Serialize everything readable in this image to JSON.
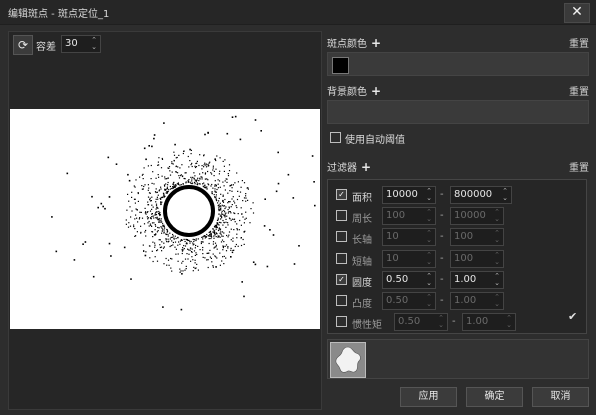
{
  "window": {
    "title": "编辑斑点 - 斑点定位_1",
    "close_glyph": "✕"
  },
  "toolbar": {
    "refresh_glyph": "⟳",
    "tolerance_label": "容差",
    "tolerance_value": "30"
  },
  "spot_color": {
    "label": "斑点颜色",
    "plus": "+",
    "reset": "重置",
    "color": "#000000"
  },
  "bg_color": {
    "label": "背景颜色",
    "plus": "+",
    "reset": "重置"
  },
  "auto_threshold": {
    "label": "使用自动阈值",
    "checked": false
  },
  "filters": {
    "label": "过滤器",
    "plus": "+",
    "reset": "重置",
    "rows": [
      {
        "name": "面积",
        "checked": true,
        "min": "10000",
        "max": "800000"
      },
      {
        "name": "周长",
        "checked": false,
        "min": "100",
        "max": "10000"
      },
      {
        "name": "长轴",
        "checked": false,
        "min": "10",
        "max": "100"
      },
      {
        "name": "短轴",
        "checked": false,
        "min": "10",
        "max": "100"
      },
      {
        "name": "圆度",
        "checked": true,
        "min": "0.50",
        "max": "1.00"
      },
      {
        "name": "凸度",
        "checked": false,
        "min": "0.50",
        "max": "1.00"
      },
      {
        "name": "惯性矩",
        "checked": false,
        "min": "0.50",
        "max": "1.00"
      }
    ],
    "confirm_glyph": "✔"
  },
  "buttons": {
    "apply": "应用",
    "ok": "确定",
    "cancel": "取消"
  },
  "spinner_arrows": "⌃⌄",
  "check_glyph": "✓"
}
